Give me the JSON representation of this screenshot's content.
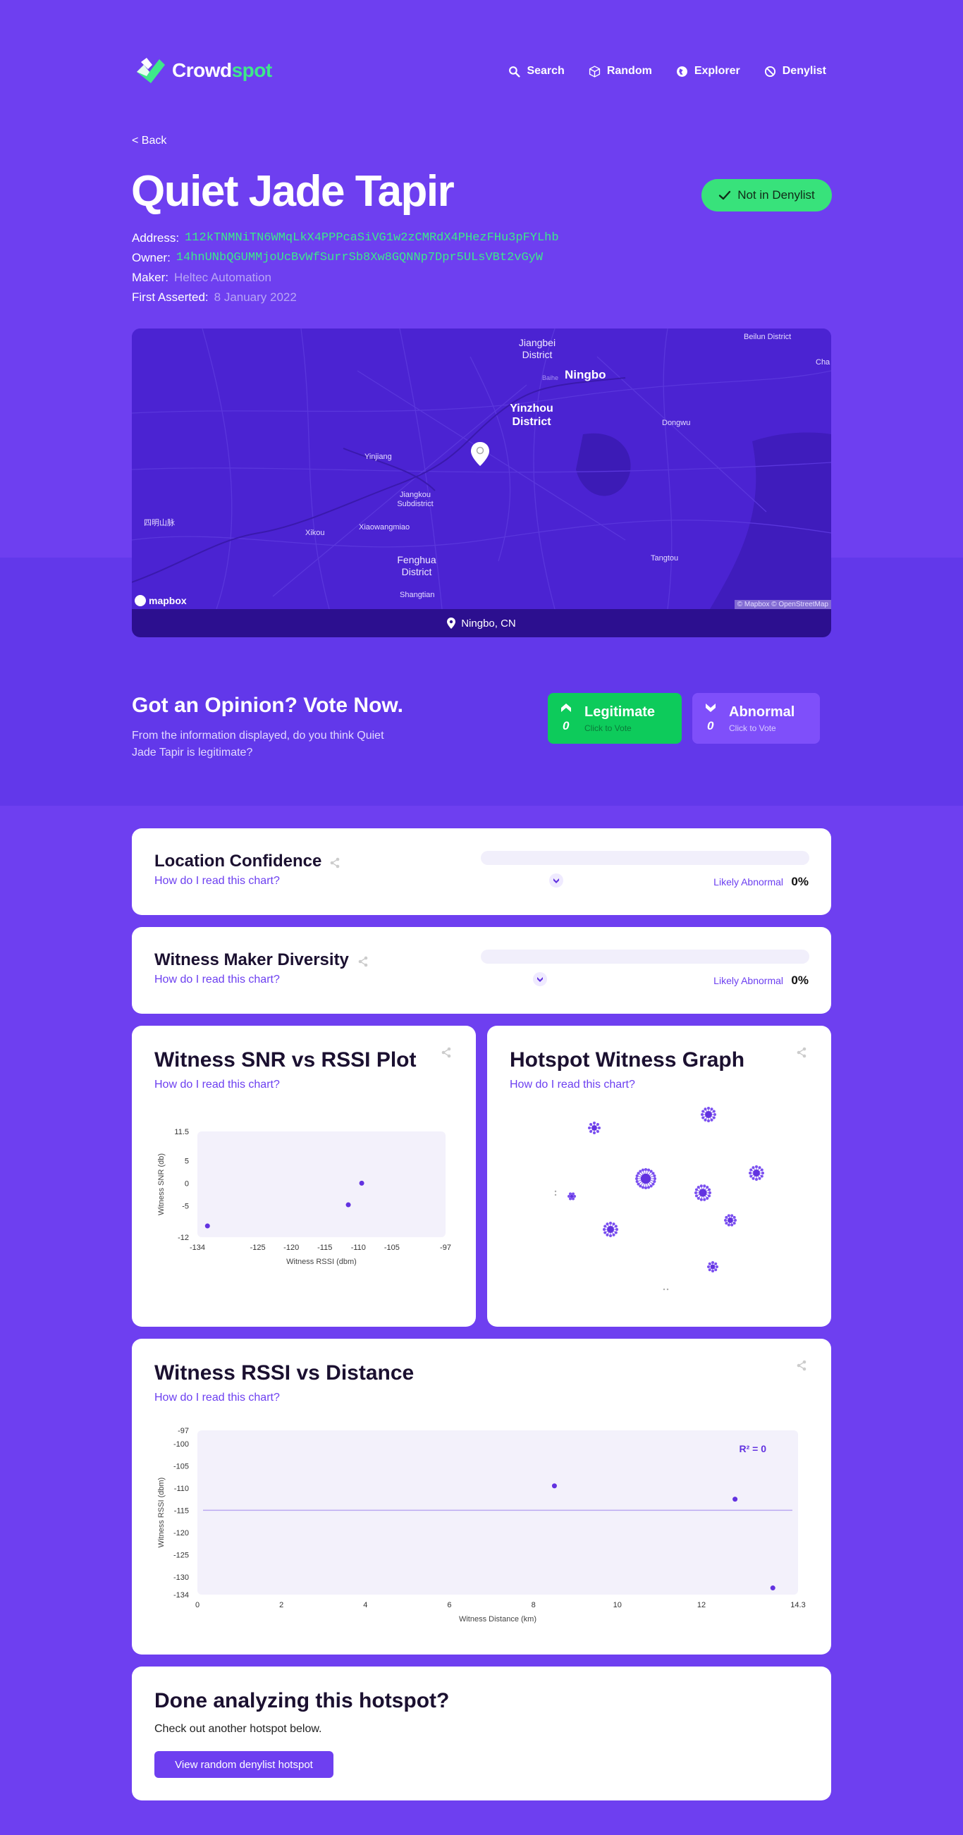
{
  "brand": {
    "name_a": "Crowd",
    "name_b": "spot"
  },
  "nav": {
    "search": "Search",
    "random": "Random",
    "explorer": "Explorer",
    "denylist": "Denylist"
  },
  "back": "< Back",
  "hotspot": {
    "name": "Quiet Jade Tapir",
    "status": "Not in Denylist",
    "address_label": "Address:",
    "address": "112kTNMNiTN6WMqLkX4PPPcaSiVG1w2zCMRdX4PHezFHu3pFYLhb",
    "owner_label": "Owner:",
    "owner": "14hnUNbQGUMMjoUcBvWfSurrSb8Xw8GQNNp7Dpr5ULsVBt2vGyW",
    "maker_label": "Maker:",
    "maker": "Heltec Automation",
    "asserted_label": "First Asserted:",
    "asserted": "8 January 2022"
  },
  "map": {
    "labels": {
      "jiangbei": "Jiangbei\nDistrict",
      "ningbo": "Ningbo",
      "beilun": "Beilun District",
      "cha": "Cha",
      "yinzhou": "Yinzhou\nDistrict",
      "dongwu": "Dongwu",
      "yinjiang": "Yinjiang",
      "jiangkou": "Jiangkou\nSubdistrict",
      "siming": "四明山脉",
      "xikou": "Xikou",
      "xiaowangmiao": "Xiaowangmiao",
      "fenghua": "Fenghua\nDistrict",
      "tangtou": "Tangtou",
      "shangtian": "Shangtian",
      "baihe": "Baihe"
    },
    "mapbox": "mapbox",
    "attribution": "© Mapbox © OpenStreetMap",
    "location": "Ningbo, CN"
  },
  "vote": {
    "title": "Got an Opinion? Vote Now.",
    "desc": "From the information displayed, do you think Quiet Jade Tapir is legitimate?",
    "legit_label": "Legitimate",
    "legit_sub": "Click to Vote",
    "legit_count": "0",
    "abnormal_label": "Abnormal",
    "abnormal_sub": "Click to Vote",
    "abnormal_count": "0"
  },
  "location_confidence": {
    "title": "Location Confidence",
    "link": "How do I read this chart?",
    "verdict": "Likely Abnormal",
    "percent": "0%",
    "level": 0.23
  },
  "witness_diversity": {
    "title": "Witness Maker Diversity",
    "link": "How do I read this chart?",
    "verdict": "Likely Abnormal",
    "percent": "0%",
    "level": 0.18
  },
  "snr_plot": {
    "title": "Witness SNR vs RSSI Plot",
    "link": "How do I read this chart?"
  },
  "witness_graph": {
    "title": "Hotspot Witness Graph",
    "link": "How do I read this chart?"
  },
  "rssi_distance": {
    "title": "Witness RSSI vs Distance",
    "link": "How do I read this chart?",
    "r2": "R² = 0"
  },
  "done": {
    "title": "Done analyzing this hotspot?",
    "desc": "Check out another hotspot below.",
    "button": "View random denylist hotspot"
  },
  "colors": {
    "background": "#6e3ff0",
    "green": "#3ee88a",
    "point": "#6232e0"
  },
  "chart_data": [
    {
      "type": "scatter",
      "title": "Witness SNR vs RSSI Plot",
      "xlabel": "Witness RSSI (dbm)",
      "ylabel": "Witness SNR (db)",
      "xlim": [
        -134,
        -97
      ],
      "ylim": [
        -12,
        11.5
      ],
      "xticks": [
        "-134",
        "-125",
        "-120",
        "-115",
        "-110",
        "-105",
        "-97"
      ],
      "yticks": [
        "11.5",
        "5",
        "0",
        "-5",
        "-12"
      ],
      "points": [
        [
          -132.5,
          -9.5
        ],
        [
          -111.5,
          -4.8
        ],
        [
          -109.5,
          0
        ]
      ]
    },
    {
      "type": "scatter",
      "title": "Witness RSSI vs Distance",
      "xlabel": "Witness Distance (km)",
      "ylabel": "Witness RSSI (dbm)",
      "xlim": [
        0,
        14.3
      ],
      "ylim": [
        -134,
        -97
      ],
      "xticks": [
        "0",
        "2",
        "4",
        "6",
        "8",
        "10",
        "12",
        "14.3"
      ],
      "yticks": [
        "-97",
        "-100",
        "-105",
        "-110",
        "-115",
        "-120",
        "-125",
        "-130",
        "-134"
      ],
      "points": [
        [
          8.5,
          -109.5
        ],
        [
          12.8,
          -112.5
        ],
        [
          13.7,
          -132.5
        ]
      ],
      "trendline_y": -115
    }
  ]
}
